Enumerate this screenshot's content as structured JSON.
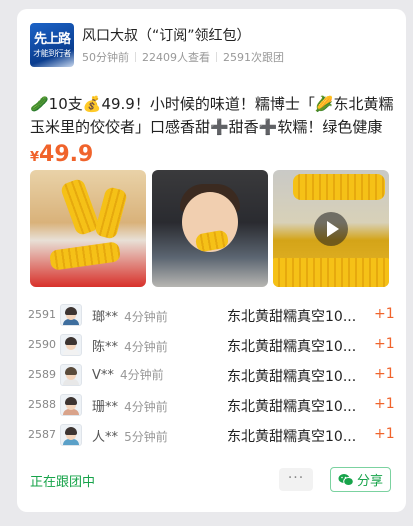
{
  "header": {
    "avatar_text_top": "先上路",
    "avatar_text_bottom": "才能到行者",
    "title": "风口大叔（“订阅”领红包）",
    "time_ago": "50分钟前",
    "views": "22409人查看",
    "joins": "2591次跟团"
  },
  "post": {
    "text": "🥒10支💰49.9！小时候的味道！糯博士「🌽东北黄糯玉米里的佼佼者」口感香甜➕甜香➕软糯！绿色健康",
    "price_symbol": "¥",
    "price_value": "49.9"
  },
  "participants": [
    {
      "num": "2591",
      "name": "瑯**",
      "time": "4分钟前",
      "item": "东北黄甜糯真空10...",
      "qty": "+1"
    },
    {
      "num": "2590",
      "name": "陈**",
      "time": "4分钟前",
      "item": "东北黄甜糯真空10...",
      "qty": "+1"
    },
    {
      "num": "2589",
      "name": "V**",
      "time": "4分钟前",
      "item": "东北黄甜糯真空10...",
      "qty": "+1"
    },
    {
      "num": "2588",
      "name": "珊**",
      "time": "4分钟前",
      "item": "东北黄甜糯真空10...",
      "qty": "+1"
    },
    {
      "num": "2587",
      "name": "人**",
      "time": "5分钟前",
      "item": "东北黄甜糯真空10...",
      "qty": "+1"
    }
  ],
  "footer": {
    "status": "正在跟团中",
    "more_label": "···",
    "share_label": "分享"
  },
  "colors": {
    "accent_orange": "#f0632b",
    "accent_green": "#17a34a"
  }
}
